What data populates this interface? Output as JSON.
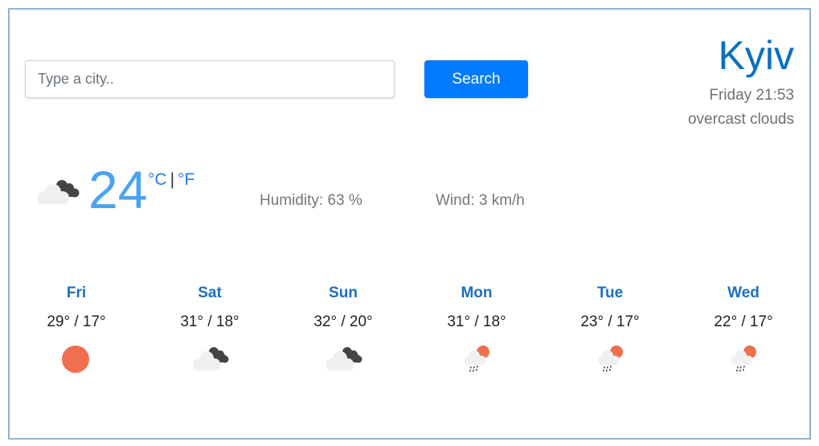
{
  "search": {
    "placeholder": "Type a city..",
    "value": "",
    "button_label": "Search"
  },
  "location": {
    "city": "Kyiv",
    "datetime": "Friday 21:53",
    "description": "overcast clouds"
  },
  "current": {
    "icon": "cloudy-dark-icon",
    "temperature": "24",
    "unit_celsius": "°C",
    "unit_separator": "|",
    "unit_fahrenheit": "°F",
    "humidity": "Humidity: 63 %",
    "wind": "Wind: 3 km/h"
  },
  "forecast": [
    {
      "day": "Fri",
      "temps": "29° / 17°",
      "icon": "sun-icon"
    },
    {
      "day": "Sat",
      "temps": "31° / 18°",
      "icon": "cloudy-dark-icon"
    },
    {
      "day": "Sun",
      "temps": "32° / 20°",
      "icon": "cloudy-dark-icon"
    },
    {
      "day": "Mon",
      "temps": "31° / 18°",
      "icon": "sun-rain-icon"
    },
    {
      "day": "Tue",
      "temps": "23° / 17°",
      "icon": "sun-rain-icon"
    },
    {
      "day": "Wed",
      "temps": "22° / 17°",
      "icon": "sun-rain-icon"
    }
  ],
  "colors": {
    "accent": "#007bff",
    "city": "#0a6fc2",
    "temperature": "#4aa3ef",
    "sun": "#ef6f4e",
    "dark_cloud": "#444444",
    "light_cloud": "#f0f0f0",
    "frame_border": "#91b3cf"
  }
}
